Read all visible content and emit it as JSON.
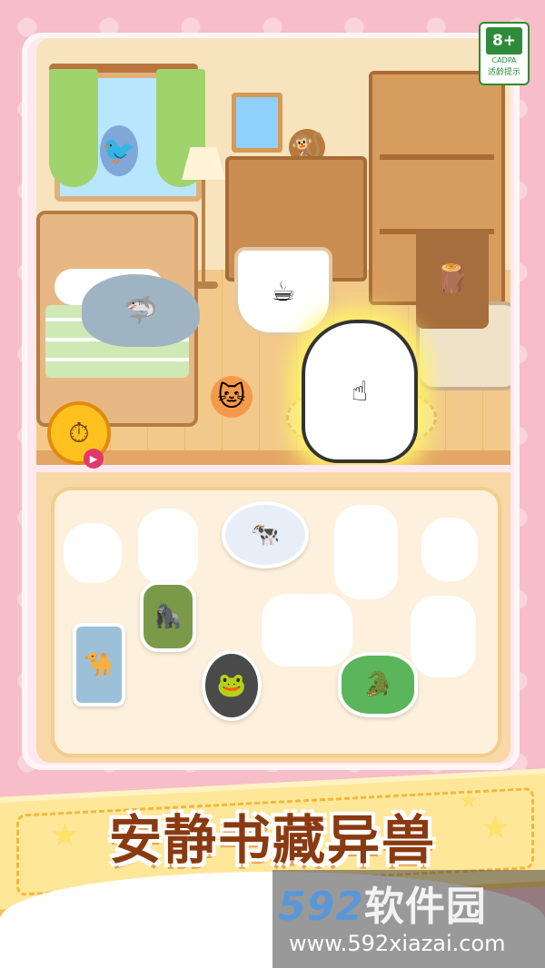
{
  "age_rating": {
    "number": "8+",
    "org": "CADPA",
    "label": "适龄提示"
  },
  "game": {
    "title": "安静书藏异兽",
    "hint_button": "clock-hint",
    "hint_badge": "video-ad"
  },
  "scene": {
    "characters": [
      "bird",
      "monkey",
      "shark",
      "cup-girl",
      "wood-man",
      "cat",
      "pointing-hand"
    ]
  },
  "tray": {
    "stickers": [
      "cow-ufo",
      "camel-fridge",
      "bigfoot",
      "frog-tire",
      "crocodile"
    ]
  },
  "watermark": {
    "brand_num": "592",
    "brand_text": "软件园",
    "url": "www.592xiazai.com"
  },
  "colors": {
    "background": "#f7bdc8",
    "banner": "#ffe79a",
    "title": "#8a3a10",
    "accent": "#2e8b3a"
  }
}
